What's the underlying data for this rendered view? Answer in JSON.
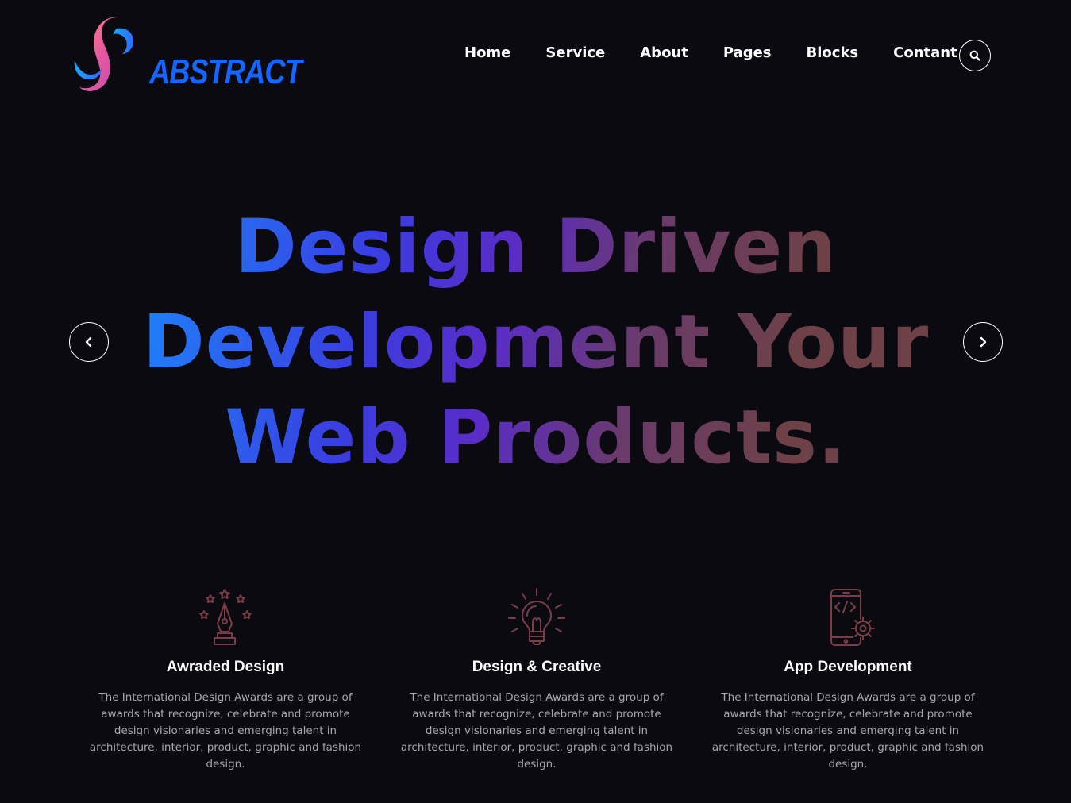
{
  "brand": {
    "name": "ABSTRACT",
    "color": "#1565ff"
  },
  "nav": {
    "items": [
      {
        "label": "Home"
      },
      {
        "label": "Service"
      },
      {
        "label": "About"
      },
      {
        "label": "Pages"
      },
      {
        "label": "Blocks"
      },
      {
        "label": "Contant"
      }
    ],
    "search_icon": "search-icon"
  },
  "hero": {
    "lines": [
      "Design Driven",
      "Development Your",
      "Web Products."
    ],
    "gradient": [
      "#1a8cff",
      "#3a3de0",
      "#5a2cc8",
      "#6e4148"
    ],
    "prev_icon": "chevron-left-icon",
    "next_icon": "chevron-right-icon"
  },
  "features": [
    {
      "icon": "pen-stars-icon",
      "title": "Awraded Design",
      "description": "The International Design Awards are a group of awards that recognize, celebrate and promote design visionaries and emerging talent in architecture, interior, product, graphic and fashion design."
    },
    {
      "icon": "lightbulb-icon",
      "title": "Design & Creative",
      "description": "The International Design Awards are a group of awards that recognize, celebrate and promote design visionaries and emerging talent in architecture, interior, product, graphic and fashion design."
    },
    {
      "icon": "mobile-code-gear-icon",
      "title": "App Development",
      "description": "The International Design Awards are a group of awards that recognize, celebrate and promote design visionaries and emerging talent in architecture, interior, product, graphic and fashion design."
    }
  ],
  "colors": {
    "background": "#0b0a11",
    "icon_stroke": "#7a3d47",
    "body_text": "#a8a6ad"
  }
}
